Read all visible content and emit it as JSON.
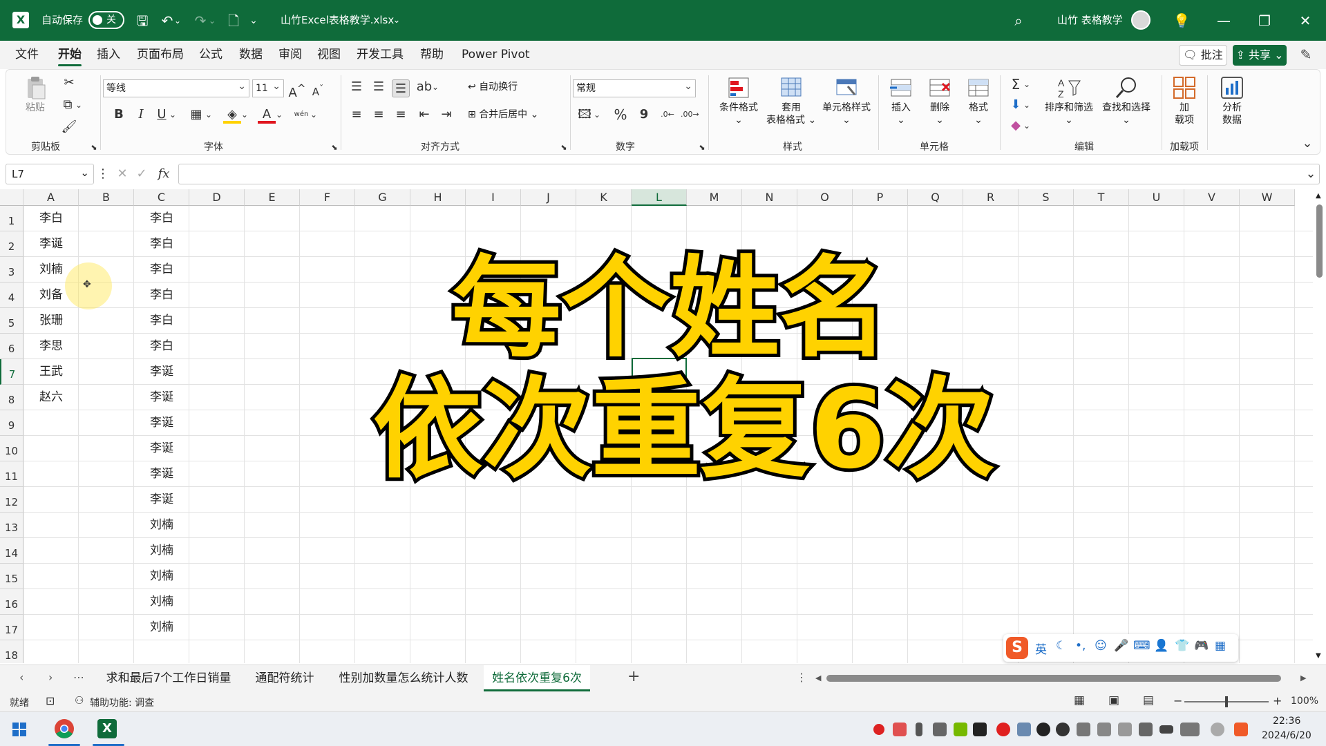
{
  "titlebar": {
    "autosave_label": "自动保存",
    "autosave_state": "关",
    "filename": "山竹Excel表格教学.xlsx",
    "user": "山竹 表格教学"
  },
  "menu": {
    "tabs": [
      "文件",
      "开始",
      "插入",
      "页面布局",
      "公式",
      "数据",
      "审阅",
      "视图",
      "开发工具",
      "帮助",
      "Power Pivot"
    ],
    "active": "开始",
    "comment_btn": "批注",
    "share_btn": "共享"
  },
  "ribbon": {
    "clipboard": {
      "paste": "粘贴",
      "label": "剪贴板"
    },
    "font": {
      "name": "等线",
      "size": "11",
      "label": "字体",
      "bold": "B",
      "italic": "I",
      "underline": "U",
      "phonetic": "wén"
    },
    "alignment": {
      "wrap": "自动换行",
      "merge": "合并后居中",
      "label": "对齐方式"
    },
    "number": {
      "format": "常规",
      "percent": "%",
      "comma": "9",
      "label": "数字"
    },
    "styles": {
      "conditional": "条件格式",
      "table_1": "套用",
      "table_2": "表格格式",
      "cell_styles": "单元格样式",
      "label": "样式"
    },
    "cells": {
      "insert": "插入",
      "delete": "删除",
      "format": "格式",
      "label": "单元格"
    },
    "editing": {
      "sort": "排序和筛选",
      "find": "查找和选择",
      "label": "编辑"
    },
    "addins": {
      "btn_1": "加",
      "btn_2": "载项",
      "label": "加载项"
    },
    "analysis": {
      "btn_1": "分析",
      "btn_2": "数据"
    }
  },
  "formula_bar": {
    "name_box": "L7",
    "fx": "fx",
    "value": ""
  },
  "columns": [
    "A",
    "B",
    "C",
    "D",
    "E",
    "F",
    "G",
    "H",
    "I",
    "J",
    "K",
    "L",
    "M",
    "N",
    "O",
    "P",
    "Q",
    "R",
    "S",
    "T",
    "U",
    "V",
    "W"
  ],
  "active_column": "L",
  "rows": [
    "1",
    "2",
    "3",
    "4",
    "5",
    "6",
    "7",
    "8",
    "9",
    "10",
    "11",
    "12",
    "13",
    "14",
    "15",
    "16",
    "17",
    "18"
  ],
  "col_a": [
    "李白",
    "李诞",
    "刘楠",
    "刘备",
    "张珊",
    "李思",
    "王武",
    "赵六"
  ],
  "col_c": [
    "李白",
    "李白",
    "李白",
    "李白",
    "李白",
    "李白",
    "李诞",
    "李诞",
    "李诞",
    "李诞",
    "李诞",
    "李诞",
    "刘楠",
    "刘楠",
    "刘楠",
    "刘楠",
    "刘楠"
  ],
  "overlay": {
    "line1": "每个姓名",
    "line2": "依次重复6次"
  },
  "sheets": [
    "求和最后7个工作日销量",
    "通配符统计",
    "性别加数量怎么统计人数",
    "姓名依次重复6次"
  ],
  "active_sheet": "姓名依次重复6次",
  "status": {
    "ready": "就绪",
    "accessibility": "辅助功能: 调查",
    "zoom": "100%"
  },
  "ime": {
    "lang": "英"
  },
  "taskbar": {
    "time": "22:36",
    "date": "2024/6/20"
  },
  "colors": {
    "excel_green": "#0f6b3a",
    "overlay_yellow": "#ffd200"
  }
}
